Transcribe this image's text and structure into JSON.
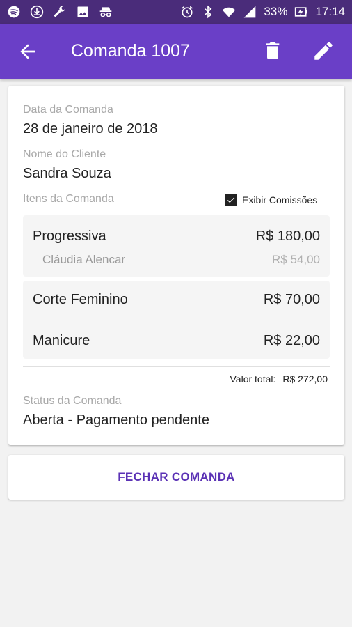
{
  "status_bar": {
    "battery": "33%",
    "time": "17:14"
  },
  "app_bar": {
    "title": "Comanda 1007"
  },
  "order": {
    "date_label": "Data da Comanda",
    "date_value": "28 de janeiro de 2018",
    "client_label": "Nome do Cliente",
    "client_value": "Sandra Souza",
    "items_label": "Itens da Comanda",
    "show_commissions_label": "Exibir Comissões",
    "show_commissions_checked": true,
    "items": [
      {
        "name": "Progressiva",
        "price": "R$ 180,00",
        "commission_name": "Cláudia Alencar",
        "commission_price": "R$ 54,00"
      },
      {
        "name": "Corte Feminino",
        "price": "R$ 70,00"
      },
      {
        "name": "Manicure",
        "price": "R$ 22,00"
      }
    ],
    "total_label": "Valor total:",
    "total_value": "R$ 272,00",
    "status_label": "Status da Comanda",
    "status_value": "Aberta - Pagamento pendente"
  },
  "actions": {
    "close_order_label": "FECHAR COMANDA"
  },
  "colors": {
    "status_bar": "#4a2c7a",
    "app_bar": "#6a3fc7",
    "accent_text": "#5b32b5",
    "background": "#f2f2f2"
  }
}
